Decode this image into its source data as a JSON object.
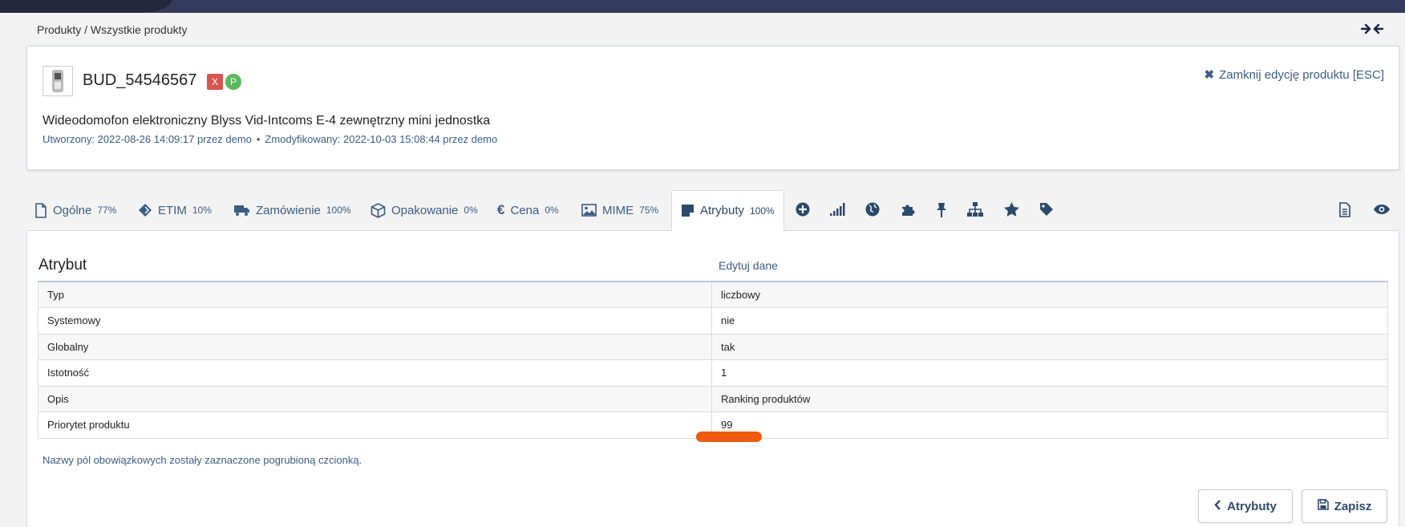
{
  "breadcrumb": "Produkty / Wszystkie produkty",
  "product": {
    "sku": "BUD_54546567",
    "badge_x": "X",
    "badge_p": "P",
    "name": "Wideodomofon elektroniczny Blyss Vid-Intcoms E-4 zewnętrzny mini jednostka",
    "created": "Utworzony: 2022-08-26 14:09:17 przez demo",
    "modified": "Zmodyfikowany: 2022-10-03 15:08:44 przez demo",
    "separator": "•"
  },
  "close_edit_label": "Zamknij edycję produktu [ESC]",
  "tabs": [
    {
      "label": "Ogólne",
      "pct": "77%",
      "icon": "file-icon"
    },
    {
      "label": "ETIM",
      "pct": "10%",
      "icon": "diamond-icon"
    },
    {
      "label": "Zamówienie",
      "pct": "100%",
      "icon": "truck-icon"
    },
    {
      "label": "Opakowanie",
      "pct": "0%",
      "icon": "box-icon"
    },
    {
      "label": "Cena",
      "pct": "0%",
      "icon": "euro-icon"
    },
    {
      "label": "MIME",
      "pct": "75%",
      "icon": "image-icon"
    },
    {
      "label": "Atrybuty",
      "pct": "100%",
      "icon": "sticky-note-icon",
      "active": true
    }
  ],
  "icon_tabs": [
    "plus-circle-icon",
    "signal-icon",
    "globe-icon",
    "puzzle-icon",
    "pin-icon",
    "sitemap-icon",
    "star-icon",
    "tag-icon"
  ],
  "right_icons": [
    "document-icon",
    "eye-icon"
  ],
  "panel": {
    "heading": "Atrybut",
    "edit_link": "Edytuj dane",
    "rows": [
      {
        "key": "Typ",
        "value": "liczbowy"
      },
      {
        "key": "Systemowy",
        "value": "nie"
      },
      {
        "key": "Globalny",
        "value": "tak"
      },
      {
        "key": "Istotność",
        "value": "1"
      },
      {
        "key": "Opis",
        "value": "Ranking produktów"
      },
      {
        "key": "Priorytet produktu",
        "value": "99"
      }
    ],
    "note": "Nazwy pól obowiązkowych zostały zaznaczone pogrubioną czcionką."
  },
  "buttons": {
    "back_label": "Atrybuty",
    "save_label": "Zapisz"
  },
  "colors": {
    "accent": "#3a5d85",
    "topbar": "#353a5c",
    "badge_red": "#d9534f",
    "badge_green": "#5cb85c",
    "highlight": "#f05a0c"
  }
}
